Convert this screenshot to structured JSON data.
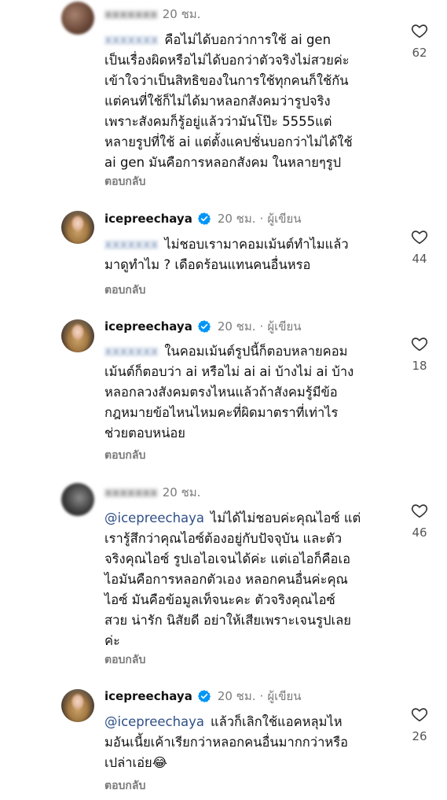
{
  "comments": [
    {
      "username": "xxxxxxx",
      "time": "20 ชม.",
      "author_tag": "",
      "mention": "xxxxxxx",
      "lines": [
        "คือไม่ได้บอกว่าการใช้ ai gen",
        "เป็นเรื่องผิดหรือไม่ได้บอกว่าตัวจริงไม่สวยค่ะ",
        "เข้าใจว่าเป็นสิทธิของในการใช้ทุกคนก็ใช้กัน",
        "แต่คนที่ใช้ก็ไม่ได้มาหลอกสังคมว่ารูปจริง",
        "เพราะสังคมก็รู้อยู่แล้วว่ามันโป๊ะ 5555แต่",
        "หลายรูปที่ใช้ ai แต่ตั้งแคปชั่นบอกว่าไม่ได้ใช้",
        "ai gen มันคือการหลอกสังคม ในหลายๆรูป"
      ],
      "reply_label": "ตอบกลับ",
      "likes": "62"
    },
    {
      "username": "icepreechaya",
      "time": "20 ชม.",
      "author_tag": "ผู้เขียน",
      "mention": "xxxxxxx",
      "lines": [
        "ไม่ชอบเรามาคอมเม้นต์ทำไมแล้ว",
        "มาดูทำไม ? เดือดร้อนแทนคนอื่นหรอ"
      ],
      "reply_label": "ตอบกลับ",
      "likes": "44"
    },
    {
      "username": "icepreechaya",
      "time": "20 ชม.",
      "author_tag": "ผู้เขียน",
      "mention": "xxxxxxx",
      "lines": [
        "ในคอมเม้นต์รูปนี้ก็ตอบหลายคอม",
        "เม้นต์ก็ตอบว่า ai หรือไม่ ai ai บ้างไม่ ai บ้าง",
        "หลอกลวงสังคมตรงไหนแล้วถ้าสังคมรู้มีข้อ",
        "กฎหมายข้อไหนไหมคะที่ผิดมาตราที่เท่าไร",
        "ช่วยตอบหน่อย"
      ],
      "reply_label": "ตอบกลับ",
      "likes": "18"
    },
    {
      "username": "xxxxxxx",
      "time": "20 ชม.",
      "author_tag": "",
      "mention": "@icepreechaya",
      "lines": [
        "ไม่ได้ไม่ชอบค่ะคุณไอซ์ แต่",
        "เรารู้สึกว่าคุณไอซ์ต้องอยู่กับปัจจุบัน และตัว",
        "จริงคุณไอซ์ รูปเอไอเจนได้ค่ะ แต่เอไอก็คือเอ",
        "ไอมันคือการหลอกตัวเอง หลอกคนอื่นค่ะคุณ",
        "ไอซ์ มันคือข้อมูลเท็จนะคะ ตัวจริงคุณไอซ์",
        "สวย น่ารัก นิสัยดี อย่าให้เสียเพราะเจนรูปเลย",
        "ค่ะ"
      ],
      "reply_label": "ตอบกลับ",
      "likes": "46"
    },
    {
      "username": "icepreechaya",
      "time": "20 ชม.",
      "author_tag": "ผู้เขียน",
      "mention": "@icepreechaya",
      "lines": [
        "แล้วก็เลิกใช้แอคหลุมไห",
        "มอันเนี้ยเค้าเรียกว่าหลอกคนอื่นมากกว่าหรือ",
        "เปล่าเอ่ย😂"
      ],
      "reply_label": "ตอบกลับ",
      "likes": "26"
    }
  ]
}
